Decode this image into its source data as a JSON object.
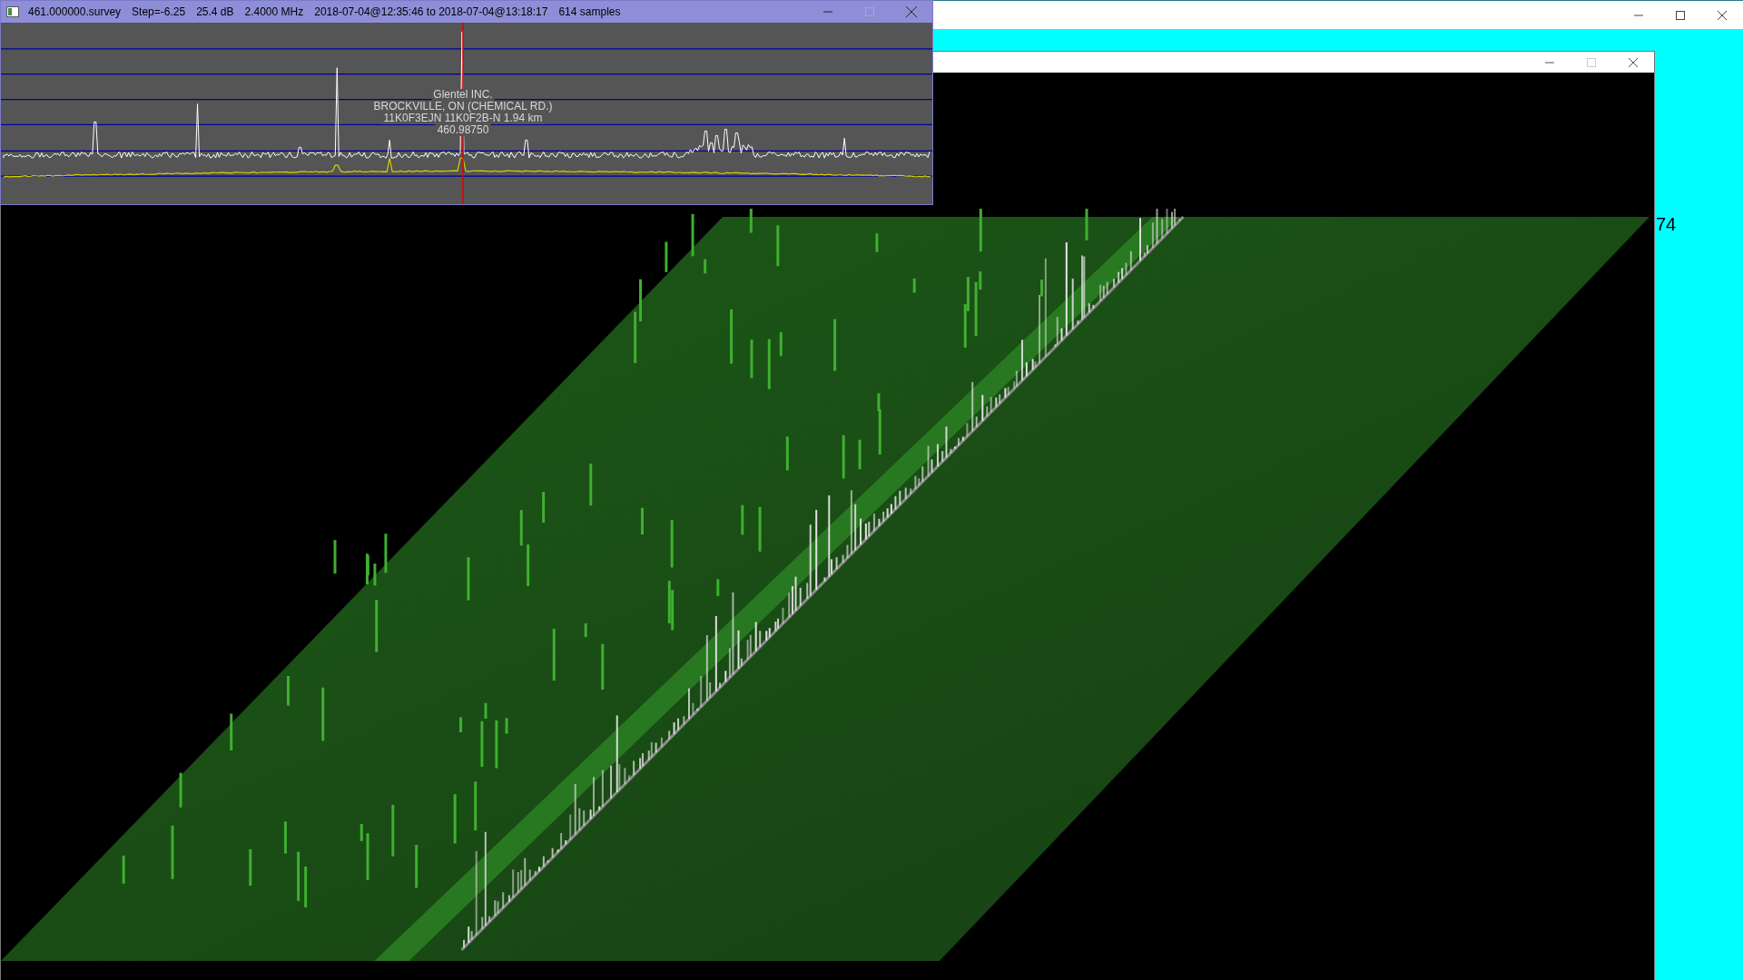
{
  "spectrum_window": {
    "title_fields": [
      "461.000000.survey",
      "Step=-6.25",
      "25.4 dB",
      "2.4000 MHz",
      "2018-07-04@12:35:46 to 2018-07-04@13:18:17",
      "614 samples"
    ],
    "annotation": [
      "Glentel INC.",
      "BROCKVILLE, ON (CHEMICAL RD.)",
      "11K0F3EJN 11K0F2B-N 1.94 km",
      "460.98750"
    ]
  },
  "background_window": {
    "label": "74"
  }
}
